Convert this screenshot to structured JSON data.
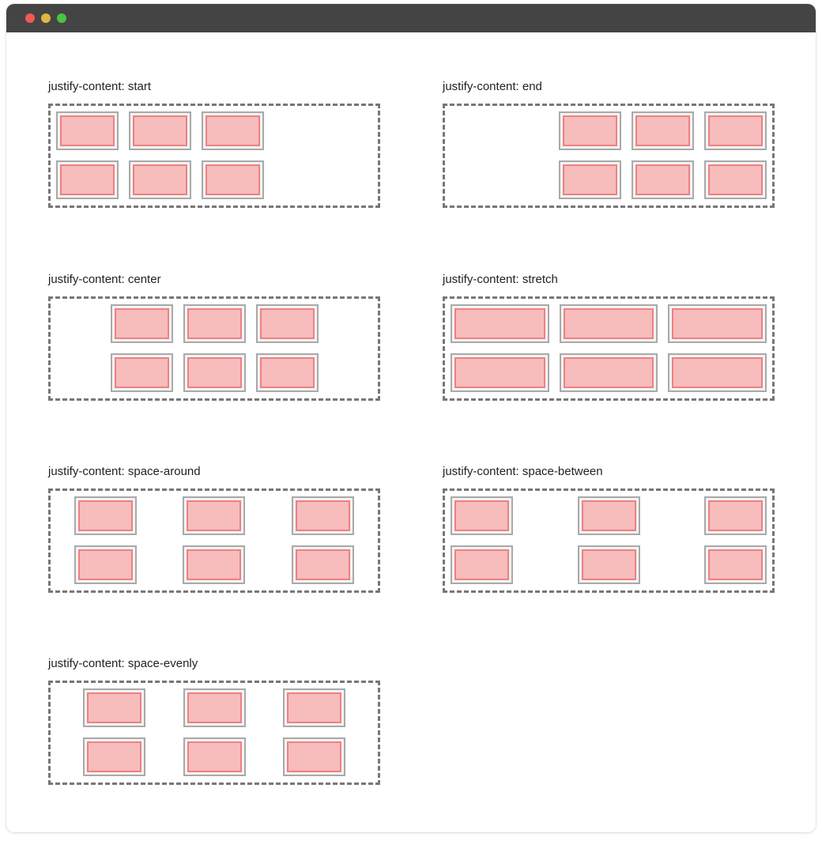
{
  "demos": [
    {
      "label": "justify-content: start",
      "mode": "start"
    },
    {
      "label": "justify-content: end",
      "mode": "end"
    },
    {
      "label": "justify-content: center",
      "mode": "center"
    },
    {
      "label": "justify-content: stretch",
      "mode": "stretch"
    },
    {
      "label": "justify-content: space-around",
      "mode": "space-around"
    },
    {
      "label": "justify-content: space-between",
      "mode": "space-between"
    },
    {
      "label": "justify-content: space-evenly",
      "mode": "space-evenly"
    }
  ],
  "colors": {
    "titlebar": "#444444",
    "close": "#f45952",
    "minimize": "#dfb641",
    "maximize": "#4bc444",
    "item_fill": "#f7bcbc",
    "item_border": "#f08080",
    "cell_border": "#a9a9a9",
    "container_border": "#777777"
  }
}
